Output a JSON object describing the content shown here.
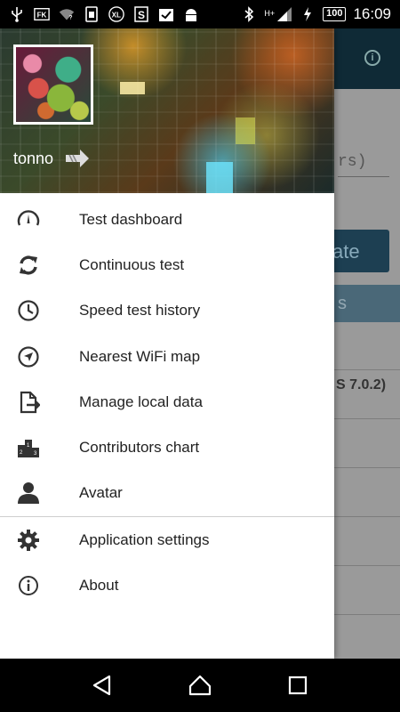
{
  "status_bar": {
    "time": "16:09",
    "battery": "100",
    "network": "H+"
  },
  "background_app": {
    "hint_fragment": "rs)",
    "button_fragment": "ate",
    "header_fragment": "s",
    "row_text_fragment": "S 7.0.2)"
  },
  "drawer": {
    "username": "tonno",
    "items": [
      {
        "label": "Test dashboard",
        "icon": "speedometer-icon"
      },
      {
        "label": "Continuous test",
        "icon": "repeat-icon"
      },
      {
        "label": "Speed test history",
        "icon": "clock-icon"
      },
      {
        "label": "Nearest WiFi map",
        "icon": "navigation-icon"
      },
      {
        "label": "Manage local data",
        "icon": "file-export-icon"
      },
      {
        "label": "Contributors chart",
        "icon": "podium-icon"
      },
      {
        "label": "Avatar",
        "icon": "person-icon"
      }
    ],
    "secondary_items": [
      {
        "label": "Application settings",
        "icon": "gear-icon"
      },
      {
        "label": "About",
        "icon": "info-icon"
      }
    ]
  }
}
